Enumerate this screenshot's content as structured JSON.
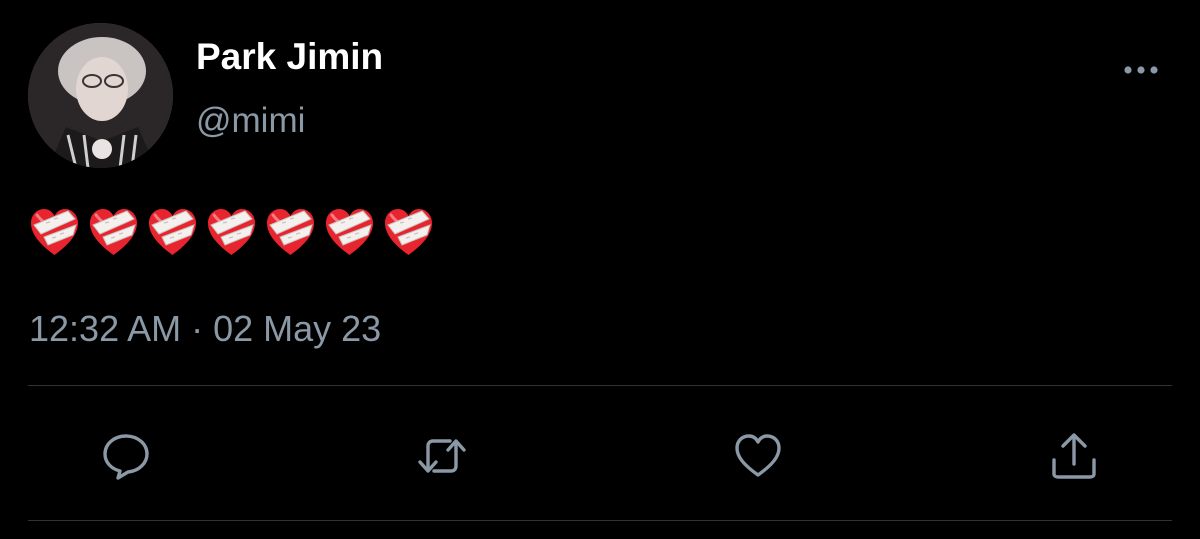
{
  "tweet": {
    "display_name": "Park Jimin",
    "handle": "@mimi",
    "text": "❤️‍🩹❤️‍🩹❤️‍🩹❤️‍🩹❤️‍🩹❤️‍🩹❤️‍🩹",
    "emoji_count": 7,
    "emoji_name": "mending-heart",
    "timestamp": "12:32 AM · 02 May 23"
  },
  "actions": {
    "icons": [
      "reply-icon",
      "retweet-icon",
      "like-icon",
      "share-icon"
    ]
  },
  "colors": {
    "background": "#000000",
    "primary_text": "#ffffff",
    "secondary_text": "#8b98a5",
    "divider": "#2f3336",
    "heart_red": "#e8242e"
  }
}
